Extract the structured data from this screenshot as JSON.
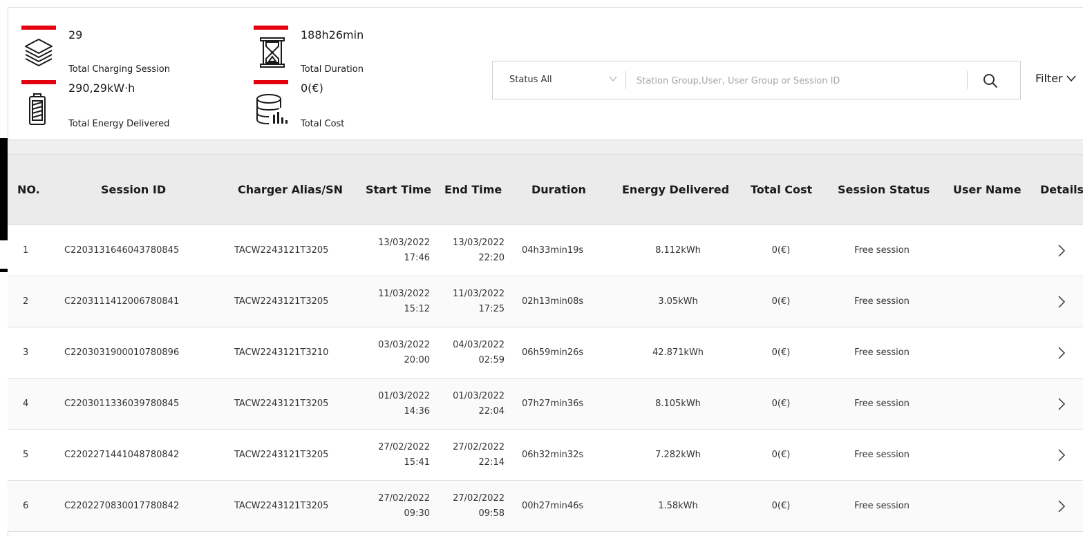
{
  "summary": {
    "sessions_count": "29",
    "sessions_label": "Total Charging Session",
    "energy_value": "290,29kW·h",
    "energy_label": "Total Energy Delivered",
    "duration_value": "188h26min",
    "duration_label": "Total Duration",
    "cost_value": "0(€)",
    "cost_label": "Total Cost"
  },
  "search": {
    "status_value": "Status All",
    "placeholder": "Station Group,User, User Group or Session ID",
    "filter_label": "Filter"
  },
  "icons": {
    "sessions": "layers-icon",
    "energy": "battery-icon",
    "duration": "hourglass-icon",
    "cost": "database-chart-icon",
    "search": "search-icon",
    "chevron_down": "chevron-down-icon",
    "chevron_right": "chevron-right-icon"
  },
  "colors": {
    "accent_red": "#e4000f",
    "header_bg": "#ebebeb"
  },
  "table": {
    "headers": {
      "no": "NO.",
      "session_id": "Session ID",
      "charger": "Charger Alias/SN",
      "start_time": "Start Time",
      "end_time": "End Time",
      "duration": "Duration",
      "energy": "Energy Delivered",
      "cost": "Total Cost",
      "status": "Session Status",
      "user": "User Name",
      "details": "Details"
    },
    "rows": [
      {
        "no": "1",
        "session_id": "C2203131646043780845",
        "charger": "TACW2243121T3205",
        "start_date": "13/03/2022",
        "start_time": "17:46",
        "end_date": "13/03/2022",
        "end_time": "22:20",
        "duration": "04h33min19s",
        "energy": "8.112kWh",
        "cost": "0(€)",
        "status": "Free session",
        "user": ""
      },
      {
        "no": "2",
        "session_id": "C2203111412006780841",
        "charger": "TACW2243121T3205",
        "start_date": "11/03/2022",
        "start_time": "15:12",
        "end_date": "11/03/2022",
        "end_time": "17:25",
        "duration": "02h13min08s",
        "energy": "3.05kWh",
        "cost": "0(€)",
        "status": "Free session",
        "user": ""
      },
      {
        "no": "3",
        "session_id": "C2203031900010780896",
        "charger": "TACW2243121T3210",
        "start_date": "03/03/2022",
        "start_time": "20:00",
        "end_date": "04/03/2022",
        "end_time": "02:59",
        "duration": "06h59min26s",
        "energy": "42.871kWh",
        "cost": "0(€)",
        "status": "Free session",
        "user": ""
      },
      {
        "no": "4",
        "session_id": "C2203011336039780845",
        "charger": "TACW2243121T3205",
        "start_date": "01/03/2022",
        "start_time": "14:36",
        "end_date": "01/03/2022",
        "end_time": "22:04",
        "duration": "07h27min36s",
        "energy": "8.105kWh",
        "cost": "0(€)",
        "status": "Free session",
        "user": ""
      },
      {
        "no": "5",
        "session_id": "C2202271441048780842",
        "charger": "TACW2243121T3205",
        "start_date": "27/02/2022",
        "start_time": "15:41",
        "end_date": "27/02/2022",
        "end_time": "22:14",
        "duration": "06h32min32s",
        "energy": "7.282kWh",
        "cost": "0(€)",
        "status": "Free session",
        "user": ""
      },
      {
        "no": "6",
        "session_id": "C2202270830017780842",
        "charger": "TACW2243121T3205",
        "start_date": "27/02/2022",
        "start_time": "09:30",
        "end_date": "27/02/2022",
        "end_time": "09:58",
        "duration": "00h27min46s",
        "energy": "1.58kWh",
        "cost": "0(€)",
        "status": "Free session",
        "user": ""
      }
    ]
  }
}
